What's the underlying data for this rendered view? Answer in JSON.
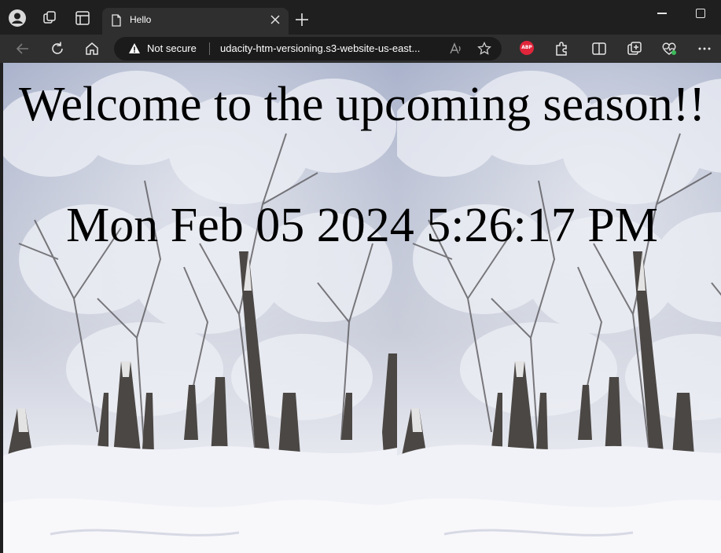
{
  "browser": {
    "tab": {
      "title": "Hello"
    },
    "address_bar": {
      "security_label": "Not secure",
      "url": "udacity-htm-versioning.s3-website-us-east..."
    },
    "extension_badge": "ABP"
  },
  "page": {
    "heading": "Welcome to the upcoming season!!",
    "datetime": "Mon Feb 05 2024 5:26:17 PM",
    "background": "snowy forest"
  },
  "colors": {
    "titlebar": "#1f1f1f",
    "toolbar": "#2f2f2f",
    "address_bar": "#1b1b1b",
    "abp_badge": "#e2253a",
    "heading_text": "#000000"
  }
}
